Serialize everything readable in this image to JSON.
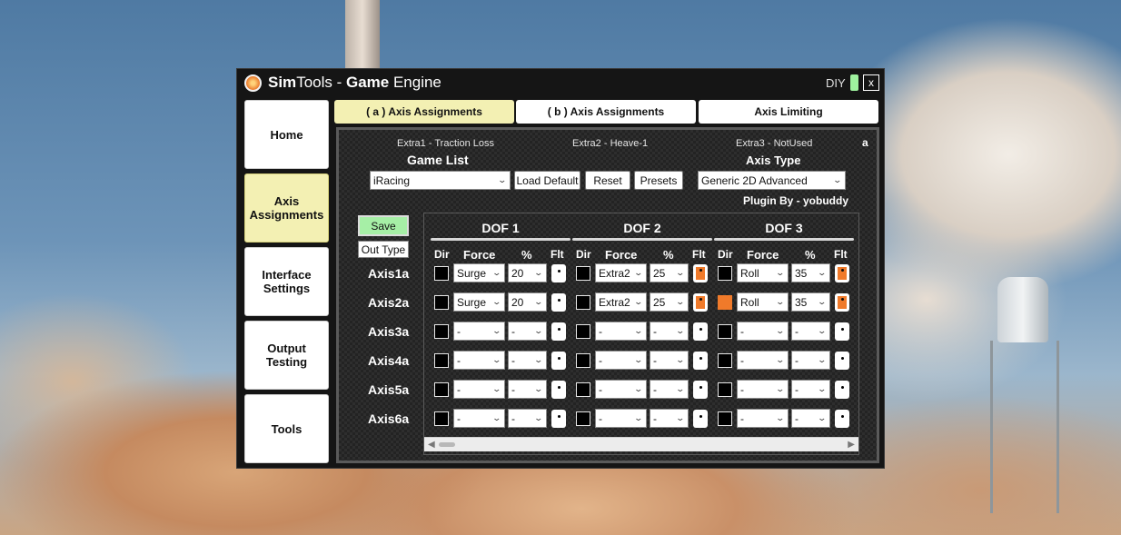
{
  "window": {
    "title_bold": "Sim",
    "title_rest": "Tools - ",
    "title_bold2": "Game",
    "title_rest2": " Engine",
    "diy_label": "DIY",
    "close_label": "x"
  },
  "nav": [
    {
      "label": "Home",
      "active": false
    },
    {
      "label": "Axis Assignments",
      "active": true
    },
    {
      "label": "Interface Settings",
      "active": false
    },
    {
      "label": "Output Testing",
      "active": false
    },
    {
      "label": "Tools",
      "active": false
    }
  ],
  "tabs": [
    {
      "label": "( a ) Axis Assignments",
      "active": true
    },
    {
      "label": "( b ) Axis Assignments",
      "active": false
    },
    {
      "label": "Axis Limiting",
      "active": false
    }
  ],
  "extras": {
    "extra1": "Extra1 - Traction Loss",
    "extra2": "Extra2 - Heave-1",
    "extra3": "Extra3 - NotUsed",
    "panel_tag": "a"
  },
  "game_list": {
    "title": "Game List",
    "selected": "iRacing",
    "load_default": "Load Default",
    "reset": "Reset",
    "presets": "Presets"
  },
  "axis_type": {
    "title": "Axis Type",
    "selected": "Generic 2D Advanced",
    "plugin_by": "Plugin By - yobuddy"
  },
  "buttons": {
    "save": "Save",
    "out_type": "Out Type"
  },
  "dof_titles": [
    "DOF 1",
    "DOF 2",
    "DOF 3"
  ],
  "col_headers": {
    "dir": "Dir",
    "force": "Force",
    "pct": "%",
    "flt": "Flt"
  },
  "axes": [
    {
      "label": "Axis1a",
      "dofs": [
        {
          "dir": false,
          "force": "Surge",
          "pct": "20",
          "flt": false
        },
        {
          "dir": false,
          "force": "Extra2",
          "pct": "25",
          "flt": true
        },
        {
          "dir": false,
          "force": "Roll",
          "pct": "35",
          "flt": true
        }
      ]
    },
    {
      "label": "Axis2a",
      "dofs": [
        {
          "dir": false,
          "force": "Surge",
          "pct": "20",
          "flt": false
        },
        {
          "dir": false,
          "force": "Extra2",
          "pct": "25",
          "flt": true
        },
        {
          "dir": true,
          "force": "Roll",
          "pct": "35",
          "flt": true
        }
      ]
    },
    {
      "label": "Axis3a",
      "dofs": [
        {
          "dir": false,
          "force": "-",
          "pct": "-",
          "flt": false
        },
        {
          "dir": false,
          "force": "-",
          "pct": "-",
          "flt": false
        },
        {
          "dir": false,
          "force": "-",
          "pct": "-",
          "flt": false
        }
      ]
    },
    {
      "label": "Axis4a",
      "dofs": [
        {
          "dir": false,
          "force": "-",
          "pct": "-",
          "flt": false
        },
        {
          "dir": false,
          "force": "-",
          "pct": "-",
          "flt": false
        },
        {
          "dir": false,
          "force": "-",
          "pct": "-",
          "flt": false
        }
      ]
    },
    {
      "label": "Axis5a",
      "dofs": [
        {
          "dir": false,
          "force": "-",
          "pct": "-",
          "flt": false
        },
        {
          "dir": false,
          "force": "-",
          "pct": "-",
          "flt": false
        },
        {
          "dir": false,
          "force": "-",
          "pct": "-",
          "flt": false
        }
      ]
    },
    {
      "label": "Axis6a",
      "dofs": [
        {
          "dir": false,
          "force": "-",
          "pct": "-",
          "flt": false
        },
        {
          "dir": false,
          "force": "-",
          "pct": "-",
          "flt": false
        },
        {
          "dir": false,
          "force": "-",
          "pct": "-",
          "flt": false
        }
      ]
    }
  ],
  "colors": {
    "accent_orange": "#f07a2a",
    "active_tab": "#f3f0b3",
    "save_green": "#a6efa6",
    "diy_indicator": "#9ff29f"
  }
}
